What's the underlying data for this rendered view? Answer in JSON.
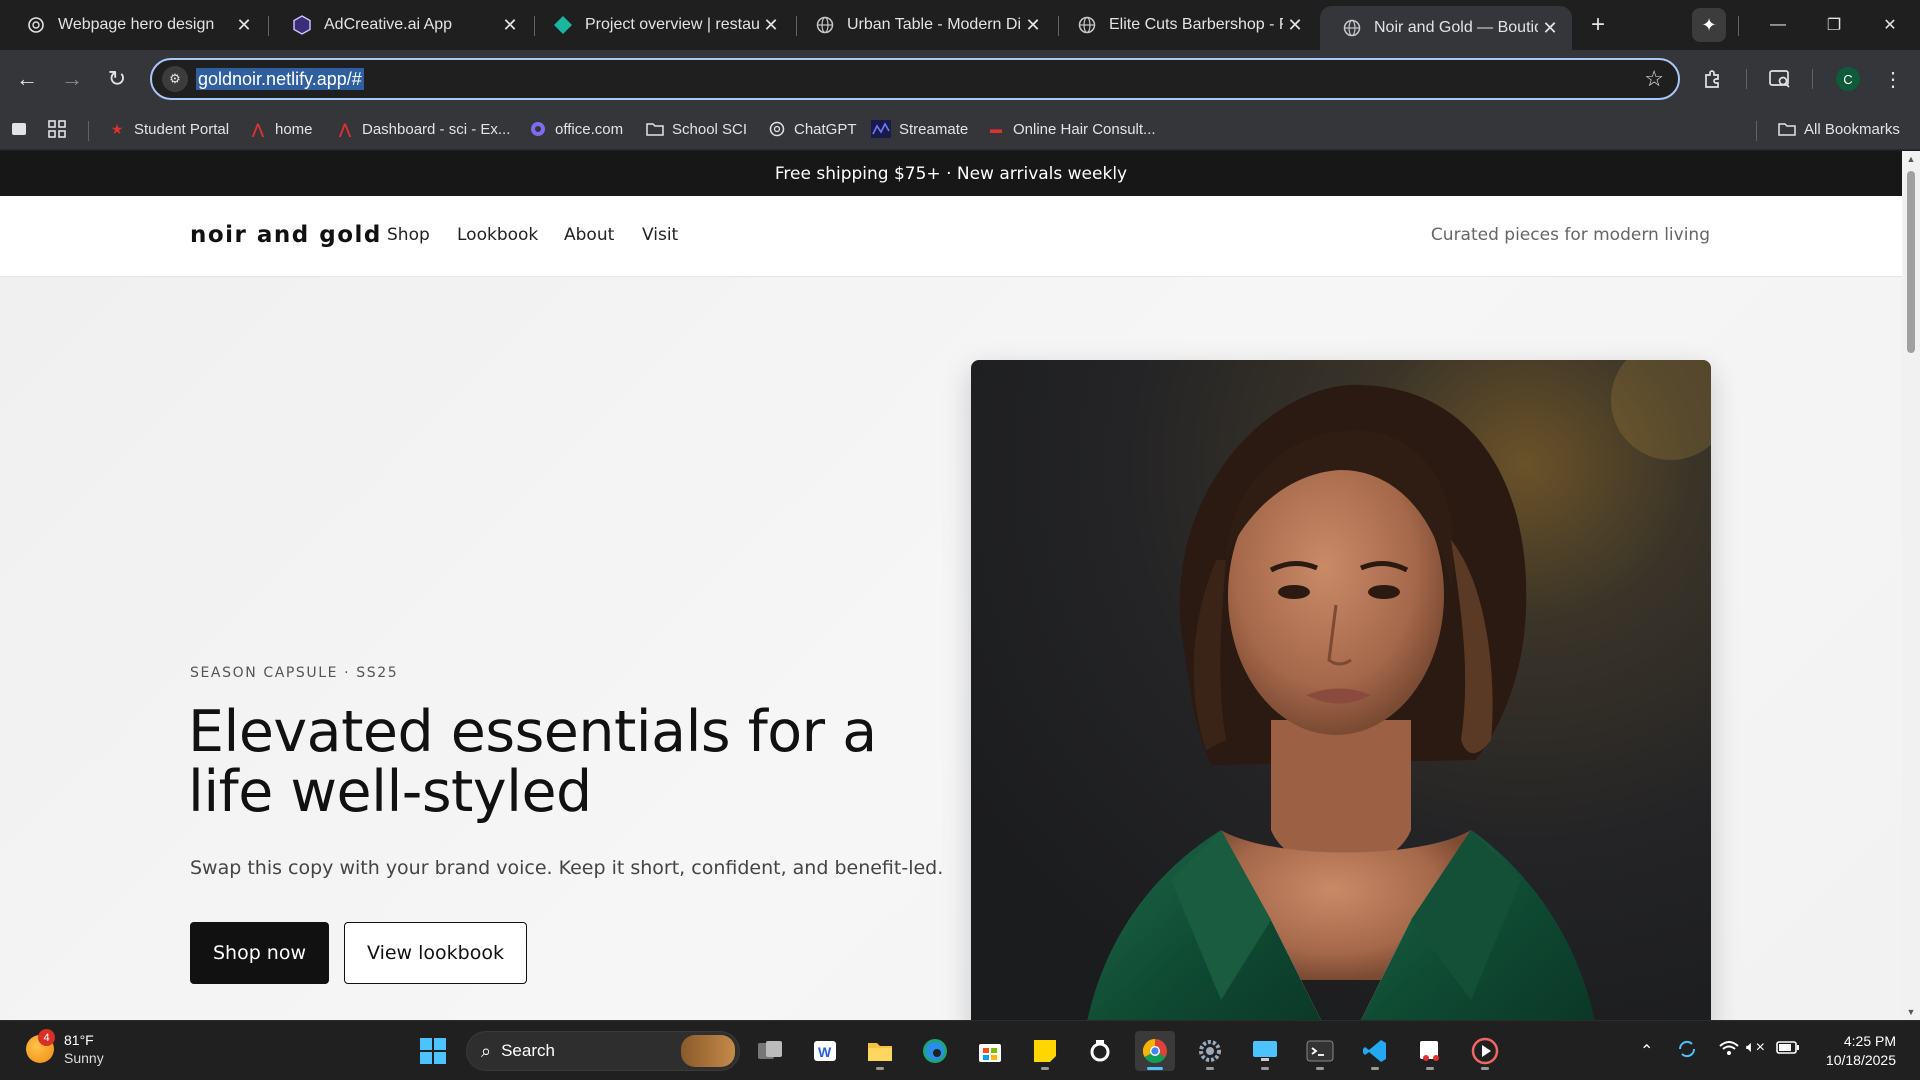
{
  "browser": {
    "tabs": [
      {
        "title": "Webpage hero design",
        "icon": "chatgpt-icon",
        "active": false
      },
      {
        "title": "AdCreative.ai App",
        "icon": "adcreative-icon",
        "active": false
      },
      {
        "title": "Project overview | restaura",
        "icon": "project-icon",
        "active": false
      },
      {
        "title": "Urban Table - Modern Din",
        "icon": "globe-icon",
        "active": false
      },
      {
        "title": "Elite Cuts Barbershop - Pr",
        "icon": "globe-icon",
        "active": false
      },
      {
        "title": "Noir and Gold — Boutique",
        "icon": "globe-icon",
        "active": true
      }
    ],
    "url": "goldnoir.netlify.app/#",
    "profile_initial": "C",
    "bookmarks": [
      {
        "label": "Student Portal",
        "icon": "star-red-icon"
      },
      {
        "label": "home",
        "icon": "a-red-icon"
      },
      {
        "label": "Dashboard - sci - Ex...",
        "icon": "a-red-icon"
      },
      {
        "label": "office.com",
        "icon": "office-icon"
      },
      {
        "label": "School SCI",
        "icon": "folder-icon"
      },
      {
        "label": "ChatGPT",
        "icon": "chatgpt-icon"
      },
      {
        "label": "Streamate",
        "icon": "streamate-icon"
      },
      {
        "label": "Online Hair Consult...",
        "icon": "hair-icon"
      }
    ],
    "all_bookmarks_label": "All Bookmarks"
  },
  "site": {
    "announcement": "Free shipping $75+ · New arrivals weekly",
    "brand": "noir and gold",
    "nav": [
      "Shop",
      "Lookbook",
      "About",
      "Visit"
    ],
    "tagline": "Curated pieces for modern living",
    "hero": {
      "eyebrow": "SEASON CAPSULE · SS25",
      "headline": "Elevated essentials for a life well-styled",
      "subcopy": "Swap this copy with your brand voice. Keep it short, confident, and benefit-led.",
      "primary_cta": "Shop now",
      "secondary_cta": "View lookbook"
    },
    "colors": {
      "dark": "#111111",
      "accent_green": "#0f4a33",
      "announce_bg": "#171717"
    }
  },
  "taskbar": {
    "weather_temp": "81°F",
    "weather_desc": "Sunny",
    "weather_badge": "4",
    "search_label": "Search",
    "time": "4:25 PM",
    "date": "10/18/2025"
  }
}
